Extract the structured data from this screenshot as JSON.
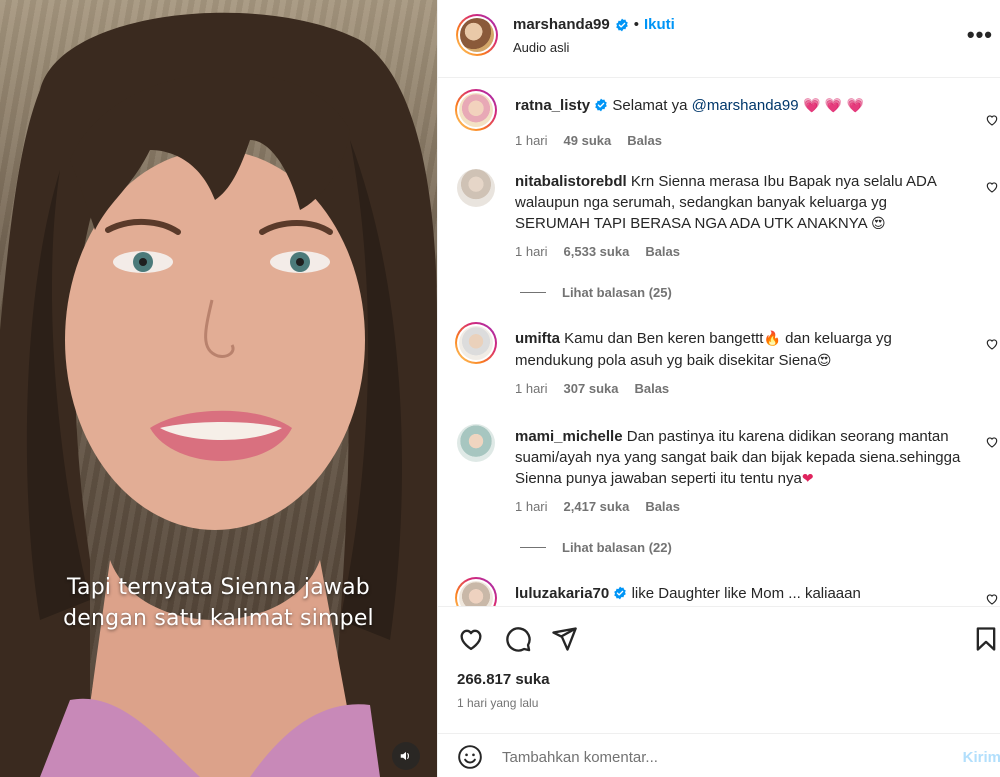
{
  "media": {
    "caption_line1": "Tapi ternyata Sienna jawab",
    "caption_line2": "dengan satu kalimat simpel",
    "sound_icon": "speaker-icon"
  },
  "header": {
    "username": "marshanda99",
    "verified": true,
    "separator": "•",
    "follow_label": "Ikuti",
    "audio_label": "Audio asli",
    "more_label": "•••"
  },
  "comments": [
    {
      "username": "ratna_listy",
      "verified": true,
      "text": "Selamat ya ",
      "mention": "@marshanda99",
      "emoji": " 💗 💗 💗",
      "age": "1 hari",
      "likes": "49 suka",
      "reply": "Balas"
    },
    {
      "username": "nitabalistorebdl",
      "verified": false,
      "text": "Krn Sienna merasa Ibu Bapak nya selalu ADA walaupun nga serumah, sedangkan banyak keluarga yg SERUMAH TAPI BERASA NGA ADA UTK ANAKNYA ",
      "emoji": "😍",
      "age": "1 hari",
      "likes": "6,533 suka",
      "reply": "Balas",
      "view_replies": "Lihat balasan (25)"
    },
    {
      "username": "umifta",
      "verified": false,
      "text_a": "Kamu dan Ben keren bangettt",
      "emoji_a": "🔥",
      "text_b": " dan keluarga yg mendukung pola asuh yg baik disekitar Siena",
      "emoji_b": "😍",
      "age": "1 hari",
      "likes": "307 suka",
      "reply": "Balas"
    },
    {
      "username": "mami_michelle",
      "verified": false,
      "text": "Dan pastinya itu karena didikan seorang mantan suami/ayah nya yang sangat baik dan bijak kepada siena.sehingga Sienna punya jawaban seperti itu tentu nya",
      "emoji": "❤",
      "age": "1 hari",
      "likes": "2,417 suka",
      "reply": "Balas",
      "view_replies": "Lihat balasan (22)"
    },
    {
      "username": "luluzakaria70",
      "verified": true,
      "text": "like Daughter like Mom ... kaliaaan"
    }
  ],
  "actions": {
    "like_icon": "heart-icon",
    "comment_icon": "comment-icon",
    "share_icon": "send-icon",
    "save_icon": "bookmark-icon"
  },
  "stats": {
    "likes": "266.817 suka",
    "time": "1 hari yang lalu"
  },
  "add_comment": {
    "placeholder": "Tambahkan komentar...",
    "send_label": "Kirim"
  },
  "colors": {
    "accent": "#0095f6",
    "text": "#262626",
    "muted": "#737373",
    "mention": "#00376b",
    "send_disabled": "#b2dffc"
  }
}
